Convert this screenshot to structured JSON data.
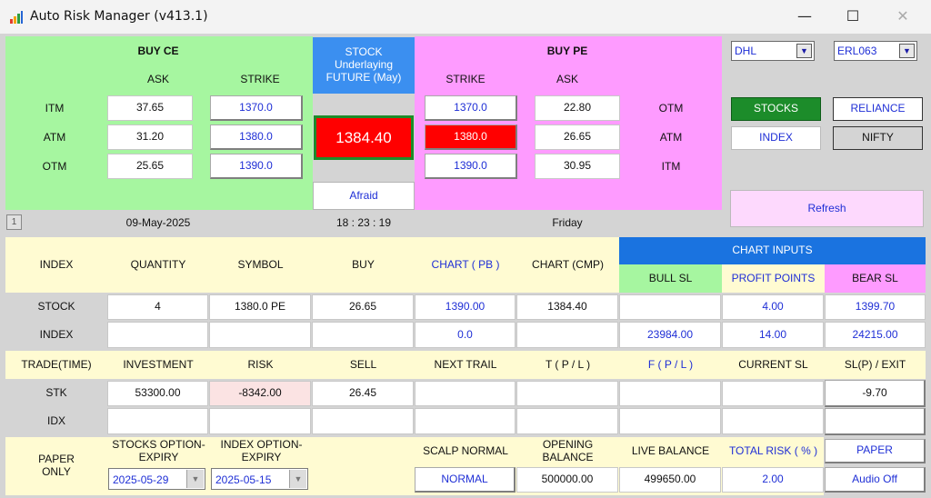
{
  "window": {
    "title": "Auto Risk Manager (v413.1)",
    "minimize": "—",
    "maximize": "☐",
    "close": "✕"
  },
  "buy_ce": {
    "title": "BUY CE",
    "ask_label": "ASK",
    "strike_label": "STRIKE",
    "rows": [
      {
        "label": "ITM",
        "ask": "37.65",
        "strike": "1370.0"
      },
      {
        "label": "ATM",
        "ask": "31.20",
        "strike": "1380.0"
      },
      {
        "label": "OTM",
        "ask": "25.65",
        "strike": "1390.0"
      }
    ]
  },
  "stock_box": {
    "title": "STOCK",
    "line2": "Underlaying",
    "line3": "FUTURE (May)",
    "price": "1384.40",
    "mood": "Afraid"
  },
  "buy_pe": {
    "title": "BUY PE",
    "strike_label": "STRIKE",
    "ask_label": "ASK",
    "rows": [
      {
        "label": "OTM",
        "ask": "22.80",
        "strike": "1370.0"
      },
      {
        "label": "ATM",
        "ask": "26.65",
        "strike": "1380.0"
      },
      {
        "label": "ITM",
        "ask": "30.95",
        "strike": "1390.0"
      }
    ]
  },
  "controls": {
    "broker": "DHL",
    "account": "ERL063",
    "stocks": "STOCKS",
    "index": "INDEX",
    "stock_symbol": "RELIANCE",
    "index_symbol": "NIFTY",
    "refresh": "Refresh"
  },
  "status": {
    "page": "1",
    "date": "09-May-2025",
    "time": "18 : 23 : 19",
    "day": "Friday"
  },
  "headers1": {
    "index": "INDEX",
    "quantity": "QUANTITY",
    "symbol": "SYMBOL",
    "buy": "BUY",
    "chart_pb": "CHART ( PB )",
    "chart_cmp": "CHART (CMP)",
    "chart_inputs": "CHART INPUTS",
    "bull_sl": "BULL SL",
    "profit_points": "PROFIT POINTS",
    "bear_sl": "BEAR SL"
  },
  "stock_row": {
    "label": "STOCK",
    "quantity": "4",
    "symbol": "1380.0  PE",
    "buy": "26.65",
    "chart_pb": "1390.00",
    "chart_cmp": "1384.40",
    "bull_sl": "",
    "profit_points": "4.00",
    "bear_sl": "1399.70"
  },
  "index_row": {
    "label": "INDEX",
    "quantity": "",
    "symbol": "",
    "buy": "",
    "chart_pb": "0.0",
    "chart_cmp": "",
    "bull_sl": "23984.00",
    "profit_points": "14.00",
    "bear_sl": "24215.00"
  },
  "headers2": {
    "trade_time": "TRADE(TIME)",
    "investment": "INVESTMENT",
    "risk": "RISK",
    "sell": "SELL",
    "next_trail": "NEXT TRAIL",
    "t_pl": "T ( P / L )",
    "f_pl": "F ( P / L )",
    "current_sl": "CURRENT SL",
    "slp_exit": "SL(P) / EXIT"
  },
  "stk_row": {
    "label": "STK",
    "investment": "53300.00",
    "risk": "-8342.00",
    "sell": "26.45",
    "slp_exit": "-9.70"
  },
  "idx_row": {
    "label": "IDX"
  },
  "bottom": {
    "paper_only": "PAPER ONLY",
    "stocks_expiry_label": "STOCKS OPTION-EXPIRY",
    "index_expiry_label": "INDEX OPTION-EXPIRY",
    "scalp_label": "SCALP NORMAL",
    "opening_label": "OPENING BALANCE",
    "live_label": "LIVE BALANCE",
    "total_risk_label": "TOTAL RISK ( % )",
    "paper_btn": "PAPER",
    "stocks_expiry": "2025-05-29",
    "index_expiry": "2025-05-15",
    "scalp_btn": "NORMAL",
    "opening_balance": "500000.00",
    "live_balance": "499650.00",
    "total_risk": "2.00",
    "audio_btn": "Audio Off"
  },
  "colors": {
    "green": "#a6f6a0",
    "pink": "#fe9bff",
    "blue_header": "#1a73e0",
    "yellow": "#fffbd2",
    "red": "#ff0000",
    "dark_green": "#1c8c2a",
    "light_pink": "#fdd9fd"
  }
}
